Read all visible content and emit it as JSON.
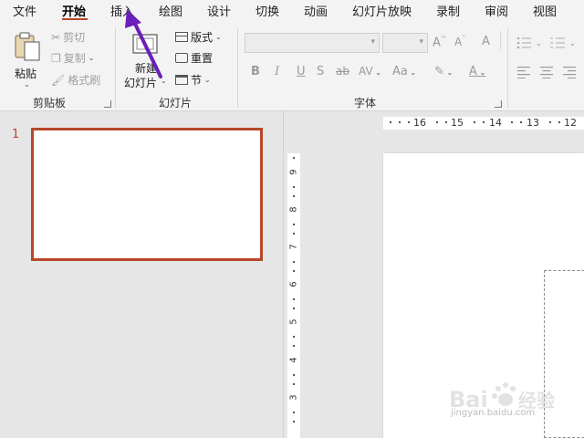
{
  "menu": {
    "tabs": [
      {
        "label": "文件"
      },
      {
        "label": "开始"
      },
      {
        "label": "插入"
      },
      {
        "label": "绘图"
      },
      {
        "label": "设计"
      },
      {
        "label": "切换"
      },
      {
        "label": "动画"
      },
      {
        "label": "幻灯片放映"
      },
      {
        "label": "录制"
      },
      {
        "label": "审阅"
      },
      {
        "label": "视图"
      }
    ],
    "active_tab": "开始"
  },
  "ribbon": {
    "clipboard": {
      "paste": "粘贴",
      "cut": "剪切",
      "copy": "复制",
      "format_painter": "格式刷",
      "group_label": "剪贴板"
    },
    "slides": {
      "new_slide_line1": "新建",
      "new_slide_line2": "幻灯片",
      "layout": "版式",
      "reset": "重置",
      "section": "节",
      "group_label": "幻灯片"
    },
    "font": {
      "group_label": "字体",
      "font_name": "",
      "font_size": "",
      "grow": "A",
      "shrink": "A",
      "clear": "A",
      "bold": "B",
      "italic": "I",
      "underline": "U",
      "shadow": "S",
      "strike": "ab",
      "spacing": "AV",
      "case": "Aa",
      "font_color": "A"
    }
  },
  "thumbnails": {
    "slide_number": "1"
  },
  "rulers": {
    "horizontal": [
      "16",
      "15",
      "14",
      "13",
      "12"
    ],
    "vertical": [
      "9",
      "8",
      "7",
      "6",
      "5",
      "4",
      "3"
    ]
  },
  "watermark": {
    "brand": "Bai",
    "brand_suffix": "经验",
    "url": "jingyan.baidu.com"
  },
  "colors": {
    "accent": "#b7472a",
    "annotation_arrow": "#6a1fb8"
  }
}
